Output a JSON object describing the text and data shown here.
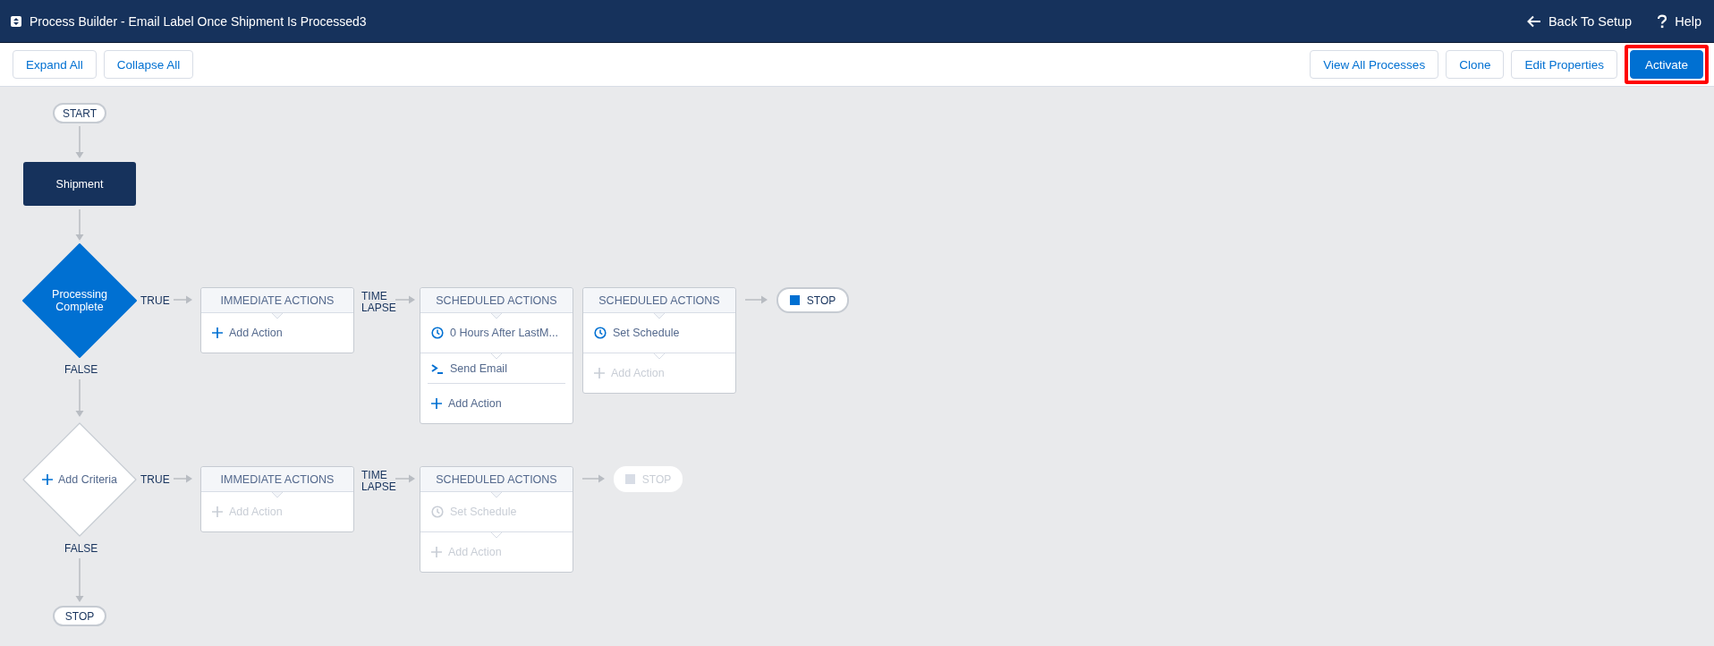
{
  "window": {
    "title": "Process Builder - Email Label Once Shipment Is Processed3"
  },
  "header_links": [
    {
      "kind": "back",
      "label": "Back To Setup"
    },
    {
      "kind": "help",
      "label": "Help"
    }
  ],
  "toolbar": {
    "left_buttons": [
      {
        "label": "Expand All",
        "primary": false,
        "highlighted": false
      },
      {
        "label": "Collapse All",
        "primary": false,
        "highlighted": false
      }
    ],
    "right_buttons": [
      {
        "label": "View All Processes",
        "primary": false,
        "highlighted": false
      },
      {
        "label": "Clone",
        "primary": false,
        "highlighted": false
      },
      {
        "label": "Edit Properties",
        "primary": false,
        "highlighted": false
      },
      {
        "label": "Activate",
        "primary": true,
        "highlighted": true
      }
    ]
  },
  "canvas": {
    "start": "START",
    "object": "Shipment",
    "end": "STOP",
    "criteria": [
      {
        "label": "Processing Complete",
        "defined": true,
        "true_label": "TRUE",
        "false_label": "FALSE",
        "time_lapse": "TIME LAPSE",
        "cards": [
          {
            "title": "IMMEDIATE ACTIONS",
            "items": [
              {
                "kind": "add",
                "label": "Add Action",
                "disabled": false
              }
            ]
          },
          {
            "title": "SCHEDULED ACTIONS",
            "items": [
              {
                "kind": "schedule",
                "label": "0 Hours After LastM...",
                "disabled": false
              },
              {
                "kind": "action",
                "label": "Send Email",
                "disabled": false
              },
              {
                "kind": "add",
                "label": "Add Action",
                "disabled": false
              }
            ]
          },
          {
            "title": "SCHEDULED ACTIONS",
            "items": [
              {
                "kind": "schedule",
                "label": "Set Schedule",
                "disabled": false
              },
              {
                "kind": "add",
                "label": "Add Action",
                "disabled": true
              }
            ]
          }
        ],
        "stop": {
          "label": "STOP",
          "disabled": false
        }
      },
      {
        "label": "Add Criteria",
        "defined": false,
        "true_label": "TRUE",
        "false_label": "FALSE",
        "time_lapse": "TIME LAPSE",
        "cards": [
          {
            "title": "IMMEDIATE ACTIONS",
            "items": [
              {
                "kind": "add",
                "label": "Add Action",
                "disabled": true
              }
            ]
          },
          {
            "title": "SCHEDULED ACTIONS",
            "items": [
              {
                "kind": "schedule",
                "label": "Set Schedule",
                "disabled": true
              },
              {
                "kind": "add",
                "label": "Add Action",
                "disabled": true
              }
            ]
          }
        ],
        "stop": {
          "label": "STOP",
          "disabled": true
        }
      }
    ]
  }
}
